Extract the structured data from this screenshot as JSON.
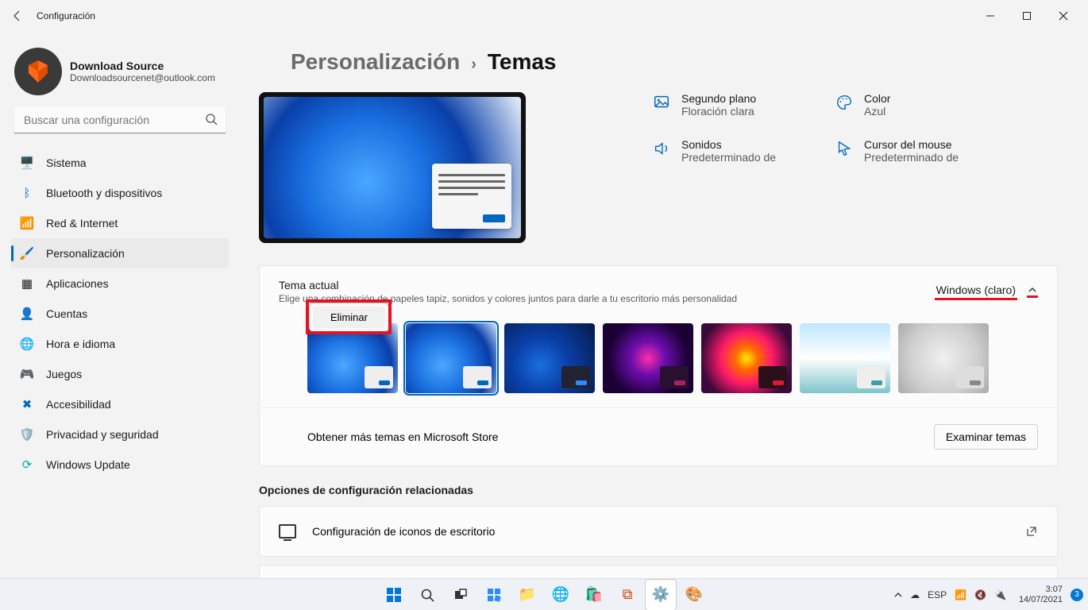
{
  "titlebar": {
    "title": "Configuración"
  },
  "profile": {
    "name": "Download Source",
    "email": "Downloadsourcenet@outlook.com"
  },
  "search": {
    "placeholder": "Buscar una configuración"
  },
  "nav": {
    "system": "Sistema",
    "bluetooth": "Bluetooth y dispositivos",
    "network": "Red & Internet",
    "personalization": "Personalización",
    "apps": "Aplicaciones",
    "accounts": "Cuentas",
    "time": "Hora e idioma",
    "gaming": "Juegos",
    "accessibility": "Accesibilidad",
    "privacy": "Privacidad y seguridad",
    "update": "Windows Update"
  },
  "breadcrumb": {
    "parent": "Personalización",
    "sep": "›",
    "current": "Temas"
  },
  "props": {
    "bg_label": "Segundo plano",
    "bg_value": "Floración clara",
    "color_label": "Color",
    "color_value": "Azul",
    "sound_label": "Sonidos",
    "sound_value": "Predeterminado de",
    "cursor_label": "Cursor del mouse",
    "cursor_value": "Predeterminado de"
  },
  "current_theme": {
    "title": "Tema actual",
    "subtitle": "Elige una combinación de papeles tapiz, sonidos y colores juntos para darle a tu escritorio más personalidad",
    "selected_label": "Windows (claro)"
  },
  "context": {
    "delete": "Eliminar"
  },
  "store": {
    "text": "Obtener más temas en Microsoft Store",
    "button": "Examinar temas"
  },
  "related": {
    "heading": "Opciones de configuración relacionadas",
    "desktop_icons": "Configuración de iconos de escritorio"
  },
  "tray": {
    "lang": "ESP",
    "time": "3:07",
    "date": "14/07/2021",
    "notif": "3"
  }
}
